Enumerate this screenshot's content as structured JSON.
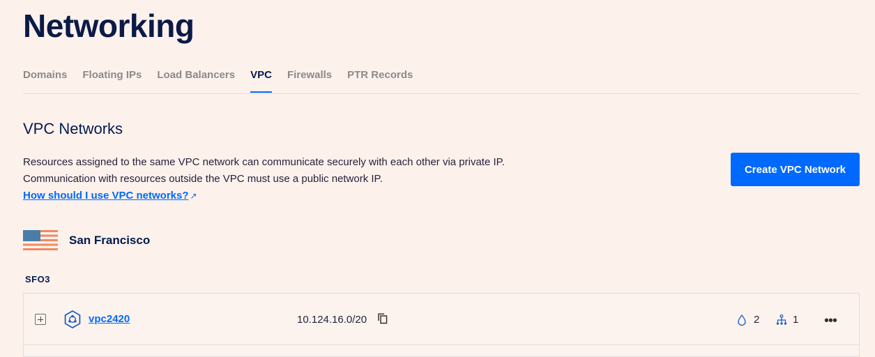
{
  "page": {
    "title": "Networking"
  },
  "tabs": [
    {
      "label": "Domains",
      "active": false
    },
    {
      "label": "Floating IPs",
      "active": false
    },
    {
      "label": "Load Balancers",
      "active": false
    },
    {
      "label": "VPC",
      "active": true
    },
    {
      "label": "Firewalls",
      "active": false
    },
    {
      "label": "PTR Records",
      "active": false
    }
  ],
  "section": {
    "title": "VPC Networks",
    "description_line1": "Resources assigned to the same VPC network can communicate securely with each other via private IP.",
    "description_line2": "Communication with resources outside the VPC must use a public network IP.",
    "help_link": "How should I use VPC networks?",
    "help_link_icon": "↗",
    "create_button": "Create VPC Network"
  },
  "region": {
    "name": "San Francisco",
    "flag_icon": "us-flag-icon",
    "datacenter": "SFO3"
  },
  "vpcs": [
    {
      "name": "vpc2420",
      "ip_range": "10.124.16.0/20",
      "droplet_count": "2",
      "load_balancer_count": "1",
      "more": "•••"
    }
  ],
  "colors": {
    "background": "#fdf1ec",
    "accent": "#0069ff",
    "text": "#031b4e",
    "muted_tab": "#8c8a89"
  }
}
